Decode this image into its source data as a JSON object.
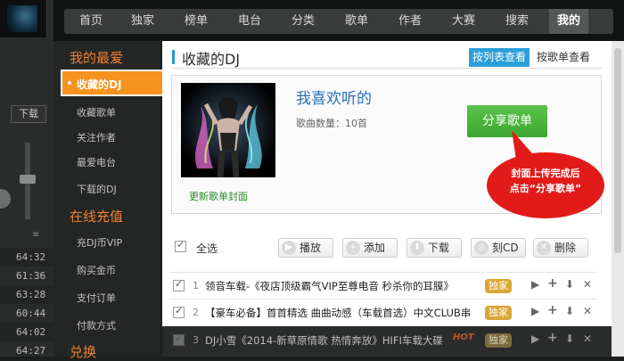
{
  "player": {
    "download_label": "下载",
    "times": [
      "64:32",
      "61:36",
      "63:28",
      "60:44",
      "64:02",
      "64:27"
    ]
  },
  "nav": {
    "items": [
      "首页",
      "独家",
      "榜单",
      "电台",
      "分类",
      "歌单",
      "作者",
      "大赛",
      "搜索",
      "我的"
    ]
  },
  "sidebar": {
    "heading1": "我的最爱",
    "active": "收藏的DJ",
    "items1": [
      "收藏歌单",
      "关注作者",
      "最爱电台",
      "下载的DJ"
    ],
    "heading2": "在线充值",
    "items2": [
      "充DJ币VIP",
      "购买金币",
      "支付订单",
      "付款方式"
    ],
    "heading3": "兑换"
  },
  "main": {
    "title": "收藏的DJ",
    "view_list": "按列表查看",
    "view_album": "按歌单查看",
    "playlist_name": "我喜欢听的",
    "count_label": "歌曲数量：10首",
    "update_cover": "更新歌单封面",
    "share_button": "分享歌单",
    "callout_line1": "封面上传完成后",
    "callout_line2": "点击“分享歌单”"
  },
  "toolbar": {
    "select_all": "全选",
    "play": "播放",
    "add": "添加",
    "download": "下载",
    "burn": "刻CD",
    "delete": "删除"
  },
  "songs": [
    {
      "num": "1",
      "title": "领音车载-《夜店顶级霸气VIP至尊电音 秒杀你的耳膜》",
      "badge": "独家"
    },
    {
      "num": "2",
      "title": "【豪车必备】首首精选 曲曲动感（车载首选）中文CLUB串",
      "badge": "独家"
    },
    {
      "num": "3",
      "title": "DJ小雪《2014-新草原情歌 热情奔放》HIFI车载大碟",
      "badge": "独家",
      "hot": "HOT"
    }
  ],
  "colors": {
    "accent_orange": "#f6921e",
    "accent_blue": "#2b9fd9",
    "share_green": "#3ea631",
    "callout_red": "#e31a1a",
    "badge_gold": "#d9a534"
  }
}
